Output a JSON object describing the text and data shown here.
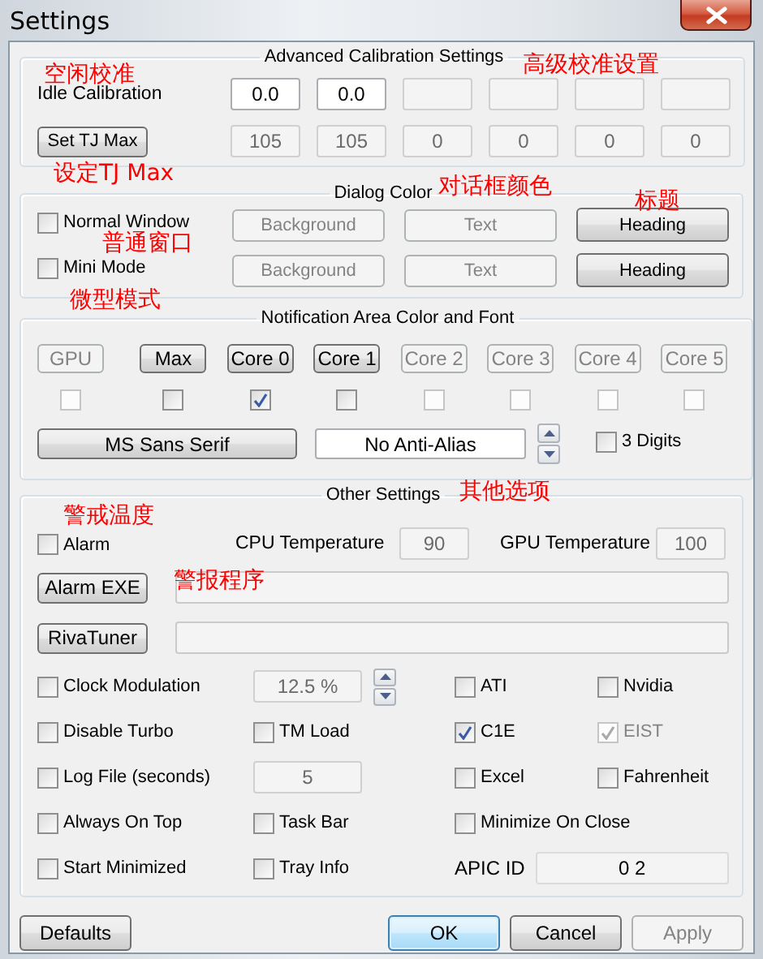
{
  "window": {
    "title": "Settings"
  },
  "calibration": {
    "title": "Advanced Calibration Settings",
    "idle_label": "Idle Calibration",
    "idle_fields": [
      {
        "value": "0.0",
        "disabled": false
      },
      {
        "value": "0.0",
        "disabled": false
      },
      {
        "disabled": true
      },
      {
        "disabled": true
      },
      {
        "disabled": true
      },
      {
        "disabled": true
      }
    ],
    "tj_button": "Set TJ Max",
    "tj_fields": [
      {
        "value": "105",
        "disabled": true
      },
      {
        "value": "105",
        "disabled": true
      },
      {
        "value": "0",
        "disabled": true
      },
      {
        "value": "0",
        "disabled": true
      },
      {
        "value": "0",
        "disabled": true
      },
      {
        "value": "0",
        "disabled": true
      }
    ]
  },
  "dialog_color": {
    "title": "Dialog Color",
    "rows": [
      {
        "label": "Normal Window",
        "checked": false,
        "buttons": [
          {
            "label": "Background",
            "disabled": true
          },
          {
            "label": "Text",
            "disabled": true
          },
          {
            "label": "Heading",
            "disabled": false
          }
        ]
      },
      {
        "label": "Mini Mode",
        "checked": false,
        "buttons": [
          {
            "label": "Background",
            "disabled": true
          },
          {
            "label": "Text",
            "disabled": true
          },
          {
            "label": "Heading",
            "disabled": false
          }
        ]
      }
    ]
  },
  "notification": {
    "title": "Notification Area Color and Font",
    "sensors": [
      {
        "label": "GPU",
        "disabled": true,
        "checked": false
      },
      {
        "label": "Max",
        "disabled": false,
        "checked": false
      },
      {
        "label": "Core 0",
        "disabled": false,
        "checked": true
      },
      {
        "label": "Core 1",
        "disabled": false,
        "checked": false
      },
      {
        "label": "Core 2",
        "disabled": true,
        "checked": false
      },
      {
        "label": "Core 3",
        "disabled": true,
        "checked": false
      },
      {
        "label": "Core 4",
        "disabled": true,
        "checked": false
      },
      {
        "label": "Core 5",
        "disabled": true,
        "checked": false
      }
    ],
    "font_button": "MS Sans Serif",
    "anti_alias": "No Anti-Alias",
    "three_digits": {
      "label": "3 Digits",
      "checked": false
    }
  },
  "other": {
    "title": "Other Settings",
    "alarm": {
      "label": "Alarm",
      "checked": false
    },
    "cpu_temperature": {
      "label": "CPU Temperature",
      "value": "90",
      "disabled": true
    },
    "gpu_temperature": {
      "label": "GPU Temperature",
      "value": "100",
      "disabled": true
    },
    "alarm_exe": "Alarm EXE",
    "rivatuner": "RivaTuner",
    "options": [
      [
        {
          "kind": "check",
          "label": "Clock Modulation",
          "checked": false,
          "disabled": false
        },
        {
          "kind": "spin",
          "value": "12.5 %",
          "disabled": true
        },
        {
          "kind": "check",
          "label": "ATI",
          "checked": false,
          "disabled": false
        },
        {
          "kind": "check",
          "label": "Nvidia",
          "checked": false,
          "disabled": false
        }
      ],
      [
        {
          "kind": "check",
          "label": "Disable Turbo",
          "checked": false,
          "disabled": false
        },
        {
          "kind": "check",
          "label": "TM Load",
          "checked": false,
          "disabled": false
        },
        {
          "kind": "check",
          "label": "C1E",
          "checked": true,
          "disabled": false
        },
        {
          "kind": "check",
          "label": "EIST",
          "checked": true,
          "disabled": true
        }
      ],
      [
        {
          "kind": "check",
          "label": "Log File (seconds)",
          "checked": false,
          "disabled": false
        },
        {
          "kind": "field",
          "value": "5",
          "disabled": true
        },
        {
          "kind": "check",
          "label": "Excel",
          "checked": false,
          "disabled": false
        },
        {
          "kind": "check",
          "label": "Fahrenheit",
          "checked": false,
          "disabled": false
        }
      ],
      [
        {
          "kind": "check",
          "label": "Always On Top",
          "checked": false,
          "disabled": false
        },
        {
          "kind": "check",
          "label": "Task Bar",
          "checked": false,
          "disabled": false
        },
        {
          "kind": "check",
          "label": "Minimize On Close",
          "checked": false,
          "disabled": false
        }
      ],
      [
        {
          "kind": "check",
          "label": "Start Minimized",
          "checked": false,
          "disabled": false
        },
        {
          "kind": "check",
          "label": "Tray Info",
          "checked": false,
          "disabled": false
        },
        {
          "kind": "readout",
          "label": "APIC ID",
          "value": "0 2"
        }
      ]
    ]
  },
  "buttons": [
    {
      "label": "Defaults",
      "default": false,
      "disabled": false
    },
    {
      "label": "OK",
      "default": true,
      "disabled": false
    },
    {
      "label": "Cancel",
      "default": false,
      "disabled": false
    },
    {
      "label": "Apply",
      "default": false,
      "disabled": true
    }
  ],
  "annotations": [
    "空闲校准",
    "高级校准设置",
    "设定TJ Max",
    "对话框颜色",
    "标题",
    "普通窗口",
    "微型模式",
    "其他选项",
    "警戒温度",
    "警报程序"
  ]
}
